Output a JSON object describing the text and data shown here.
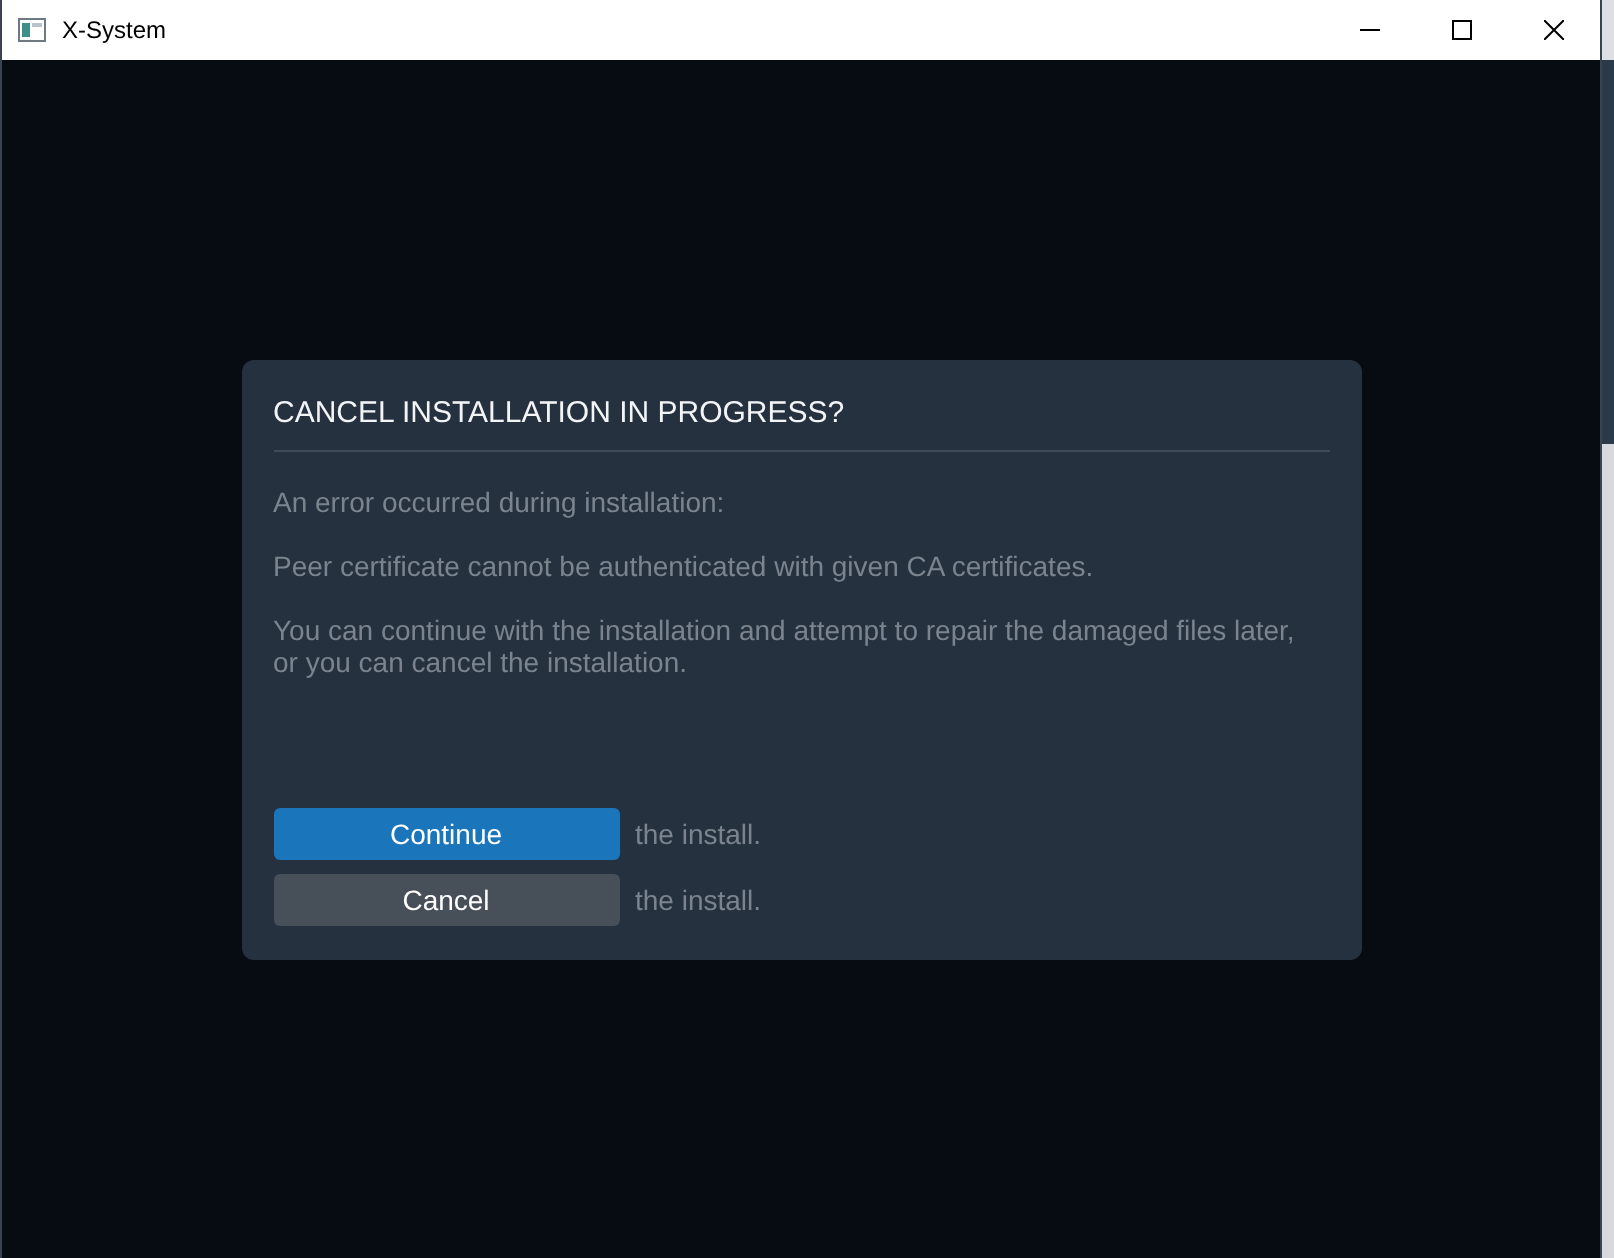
{
  "window": {
    "title": "X-System"
  },
  "dialog": {
    "title": "CANCEL INSTALLATION IN PROGRESS?",
    "paragraphs": [
      "An error occurred during installation:",
      "Peer certificate cannot be authenticated with given CA certificates.",
      "You can continue with the installation and attempt to repair the damaged files later, or you can cancel the installation."
    ],
    "actions": [
      {
        "kind": "primary",
        "label": "Continue",
        "note": "the install."
      },
      {
        "kind": "secondary",
        "label": "Cancel",
        "note": "the install."
      }
    ]
  }
}
